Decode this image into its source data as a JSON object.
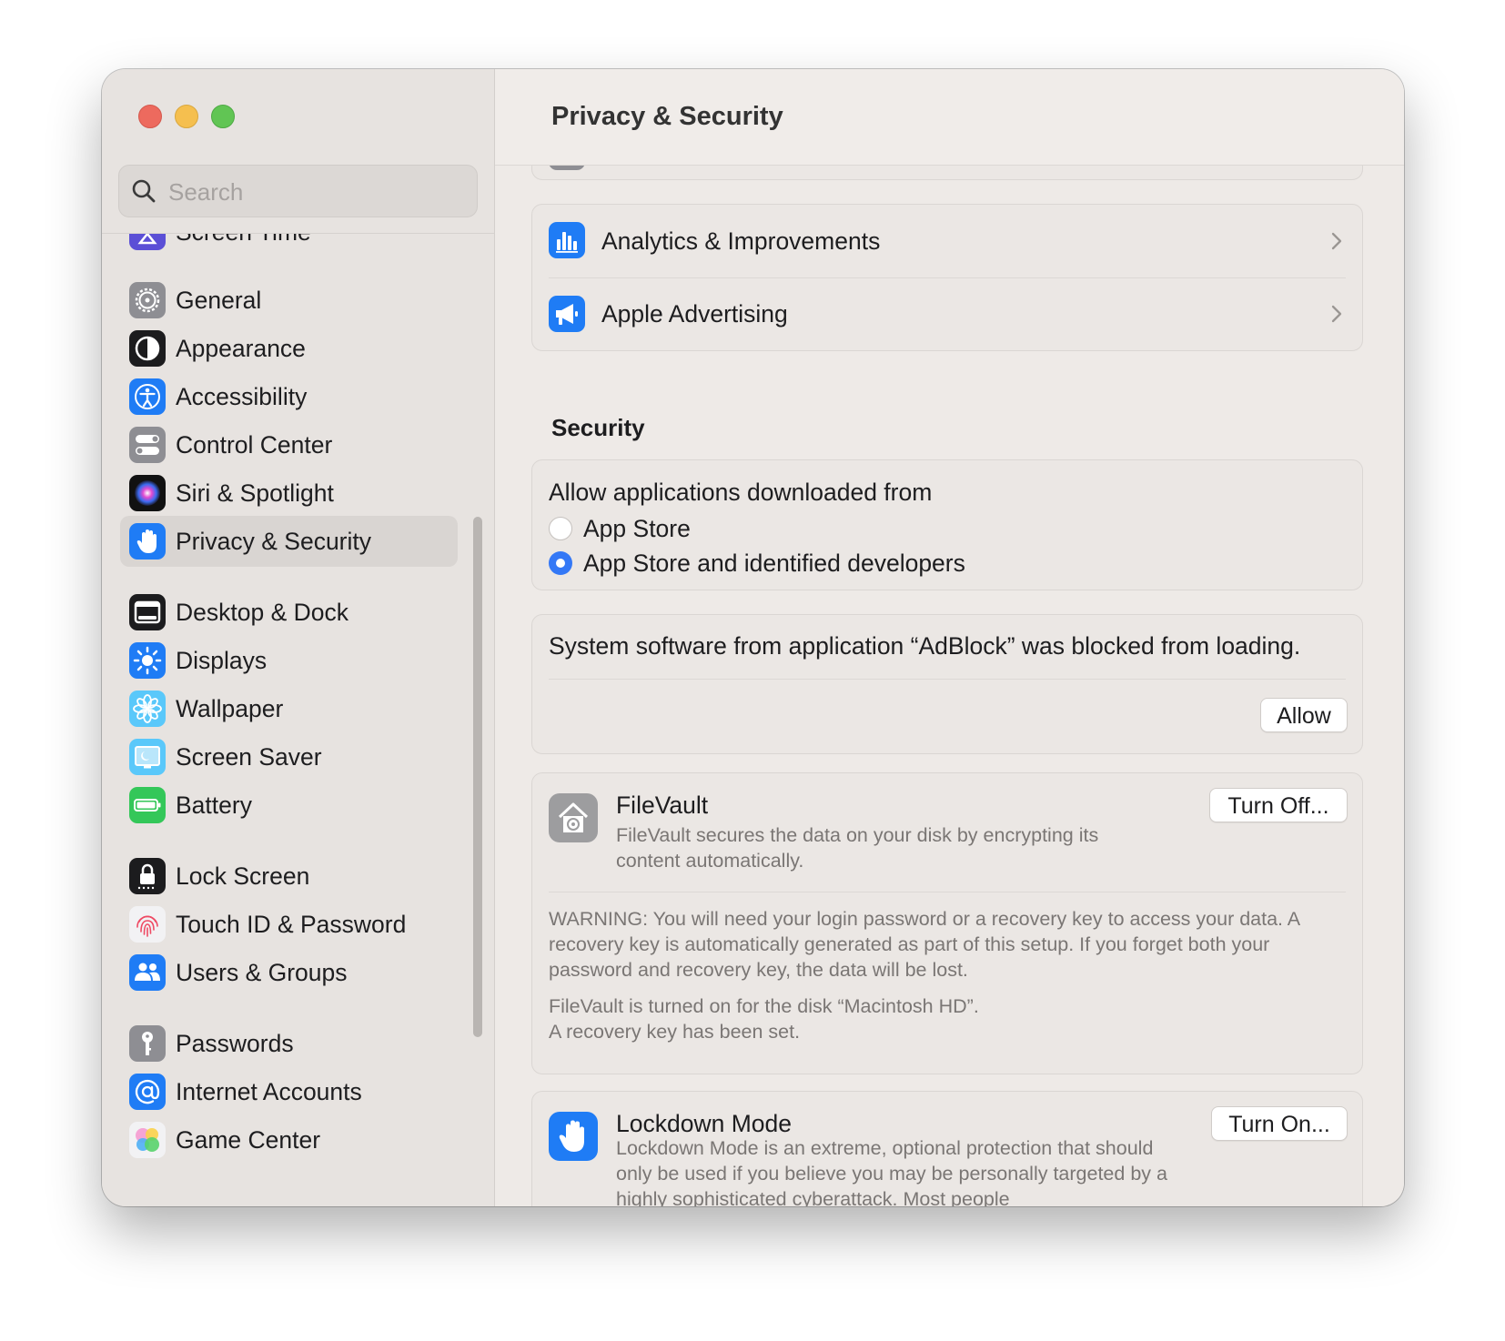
{
  "window": {
    "title": "Privacy & Security"
  },
  "sidebar": {
    "search_placeholder": "Search",
    "partial_item": "Screen Time",
    "items": [
      {
        "label": "General",
        "icon": "gear-icon"
      },
      {
        "label": "Appearance",
        "icon": "appearance-icon"
      },
      {
        "label": "Accessibility",
        "icon": "accessibility-icon"
      },
      {
        "label": "Control Center",
        "icon": "control-center-icon"
      },
      {
        "label": "Siri & Spotlight",
        "icon": "siri-icon"
      },
      {
        "label": "Privacy & Security",
        "icon": "hand-icon",
        "selected": true
      },
      {
        "label": "Desktop & Dock",
        "icon": "dock-icon"
      },
      {
        "label": "Displays",
        "icon": "sun-icon"
      },
      {
        "label": "Wallpaper",
        "icon": "flower-icon"
      },
      {
        "label": "Screen Saver",
        "icon": "screen-saver-icon"
      },
      {
        "label": "Battery",
        "icon": "battery-icon"
      },
      {
        "label": "Lock Screen",
        "icon": "lock-icon"
      },
      {
        "label": "Touch ID & Password",
        "icon": "fingerprint-icon"
      },
      {
        "label": "Users & Groups",
        "icon": "users-icon"
      },
      {
        "label": "Passwords",
        "icon": "key-icon"
      },
      {
        "label": "Internet Accounts",
        "icon": "at-icon"
      },
      {
        "label": "Game Center",
        "icon": "game-center-icon"
      }
    ]
  },
  "privacy": {
    "analytics_label": "Analytics & Improvements",
    "advertising_label": "Apple Advertising"
  },
  "security": {
    "section_title": "Security",
    "allow_apps_label": "Allow applications downloaded from",
    "option_app_store": "App Store",
    "option_identified": "App Store and identified developers",
    "selected_option": "App Store and identified developers",
    "blocked_message": "System software from application “AdBlock” was blocked from loading.",
    "allow_button": "Allow",
    "filevault": {
      "title": "FileVault",
      "description": "FileVault secures the data on your disk by encrypting its content automatically.",
      "button": "Turn Off...",
      "warning": "WARNING: You will need your login password or a recovery key to access your data. A recovery key is automatically generated as part of this setup. If you forget both your password and recovery key, the data will be lost.",
      "status_line1": "FileVault is turned on for the disk “Macintosh HD”.",
      "status_line2": "A recovery key has been set."
    },
    "lockdown": {
      "title": "Lockdown Mode",
      "description": "Lockdown Mode is an extreme, optional protection that should only be used if you believe you may be personally targeted by a highly sophisticated cyberattack. Most people",
      "button": "Turn On..."
    }
  },
  "colors": {
    "accent": "#3478f6",
    "close": "#ed6a5e",
    "minimize": "#f5bf4f",
    "maximize": "#61c554"
  }
}
